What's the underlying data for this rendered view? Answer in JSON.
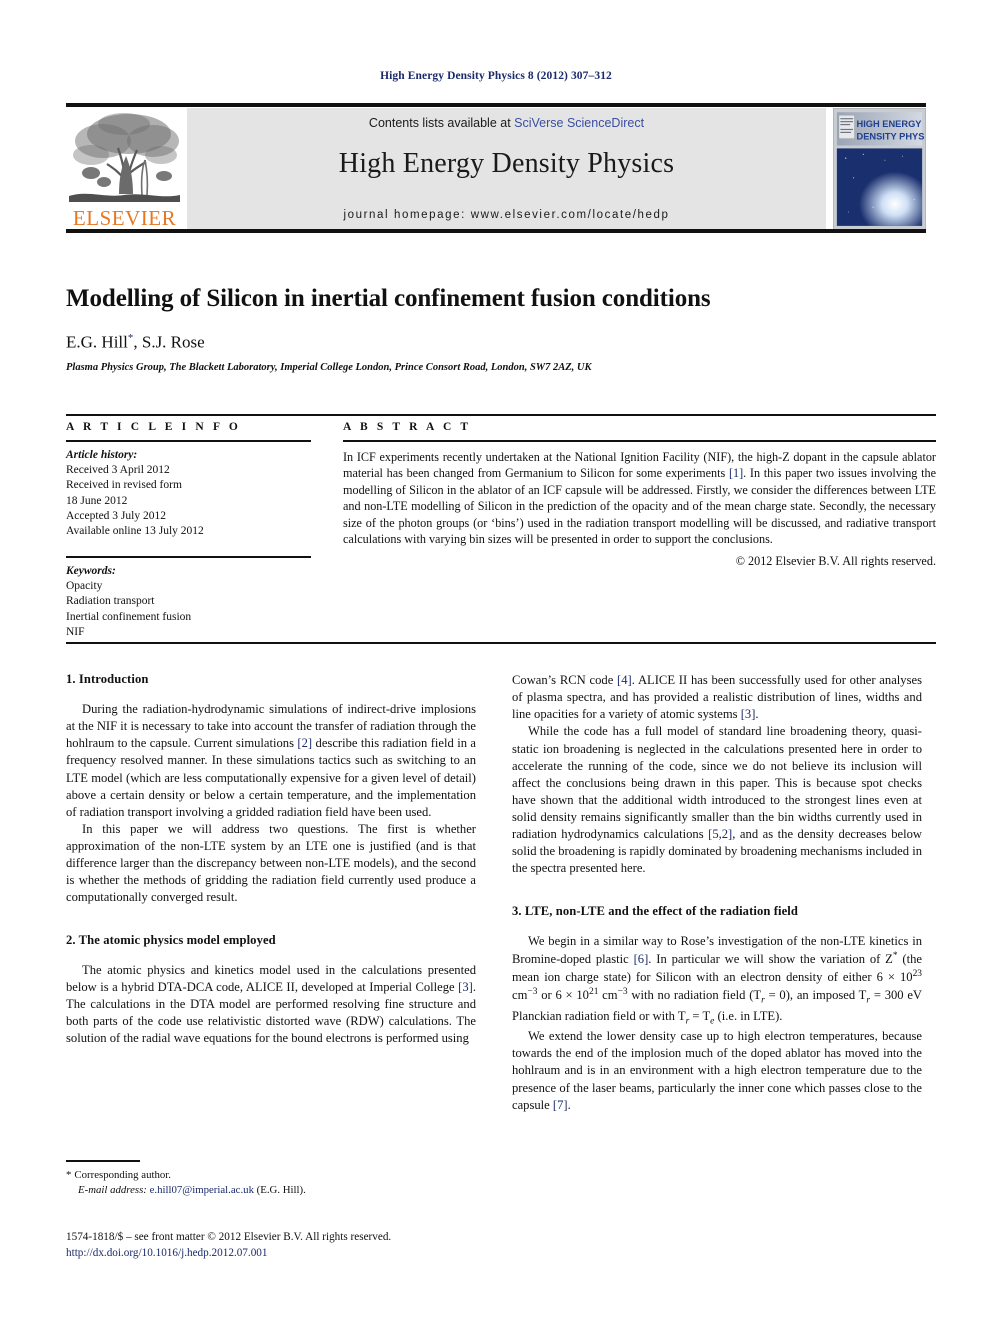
{
  "running_head": "High Energy Density Physics 8 (2012) 307–312",
  "masthead": {
    "publisher_name": "ELSEVIER",
    "contents_prefix": "Contents lists available at ",
    "contents_link": "SciVerse ScienceDirect",
    "journal_title": "High Energy Density Physics",
    "homepage": "journal homepage: www.elsevier.com/locate/hedp",
    "cover_title_line1": "HIGH ENERGY",
    "cover_title_line2": "DENSITY PHYSICS"
  },
  "article": {
    "title": "Modelling of Silicon in inertial confinement fusion conditions",
    "authors": "E.G. Hill",
    "authors_rest": ", S.J. Rose",
    "corresponding_marker": "*",
    "affiliation": "Plasma Physics Group, The Blackett Laboratory, Imperial College London, Prince Consort Road, London, SW7 2AZ, UK"
  },
  "info": {
    "heading": "A R T I C L E   I N F O",
    "history_label": "Article history:",
    "history": [
      "Received 3 April 2012",
      "Received in revised form",
      "18 June 2012",
      "Accepted 3 July 2012",
      "Available online 13 July 2012"
    ],
    "keywords_label": "Keywords:",
    "keywords": [
      "Opacity",
      "Radiation transport",
      "Inertial confinement fusion",
      "NIF"
    ]
  },
  "abstract": {
    "heading": "A B S T R A C T",
    "part1": "In ICF experiments recently undertaken at the National Ignition Facility (NIF), the high-Z dopant in the capsule ablator material has been changed from Germanium to Silicon for some experiments ",
    "ref1": "[1]",
    "part2": ". In this paper two issues involving the modelling of Silicon in the ablator of an ICF capsule will be addressed. Firstly, we consider the differences between LTE and non-LTE modelling of Silicon in the prediction of the opacity and of the mean charge state. Secondly, the necessary size of the photon groups (or ‘bins’) used in the radiation transport modelling will be discussed, and radiative transport calculations with varying bin sizes will be presented in order to support the conclusions.",
    "copyright": "© 2012 Elsevier B.V. All rights reserved."
  },
  "sections": {
    "intro_heading": "1.  Introduction",
    "intro_p1_a": "During the radiation-hydrodynamic simulations of indirect-drive implosions at the NIF it is necessary to take into account the transfer of radiation through the hohlraum to the capsule. Current simulations ",
    "intro_p1_ref": "[2]",
    "intro_p1_b": " describe this radiation field in a frequency resolved manner. In these simulations tactics such as switching to an LTE model (which are less computationally expensive for a given level of detail) above a certain density or below a certain temperature, and the implementation of radiation transport involving a gridded radiation field have been used.",
    "intro_p2": "In this paper we will address two questions. The first is whether approximation of the non-LTE system by an LTE one is justified (and is that difference larger than the discrepancy between non-LTE models), and the second is whether the methods of gridding the radiation field currently used produce a computationally converged result.",
    "atomic_heading": "2.  The atomic physics model employed",
    "atomic_p1_a": "The atomic physics and kinetics model used in the calculations presented below is a hybrid DTA-DCA code, ALICE II, developed at Imperial College ",
    "atomic_p1_ref": "[3]",
    "atomic_p1_b": ". The calculations in the DTA model are performed resolving fine structure and both parts of the code use relativistic distorted wave (RDW) calculations. The solution of the radial wave equations for the bound electrons is performed using",
    "right_p1_a": "Cowan’s RCN code ",
    "right_p1_ref1": "[4]",
    "right_p1_b": ". ALICE II has been successfully used for other analyses of plasma spectra, and has provided a realistic distribution of lines, widths and line opacities for a variety of atomic systems ",
    "right_p1_ref2": "[3]",
    "right_p1_c": ".",
    "right_p2_a": "While the code has a full model of standard line broadening theory, quasi-static ion broadening is neglected in the calculations presented here in order to accelerate the running of the code, since we do not believe its inclusion will affect the conclusions being drawn in this paper. This is because spot checks have shown that the additional width introduced to the strongest lines even at solid density remains significantly smaller than the bin widths currently used in radiation hydrodynamics calculations ",
    "right_p2_ref": "[5,2]",
    "right_p2_b": ", and as the density decreases below solid the broadening is rapidly dominated by broadening mechanisms included in the spectra presented here.",
    "lte_heading": "3.  LTE, non-LTE and the effect of the radiation field",
    "lte_p1_a": "We begin in a similar way to Rose’s investigation of the non-LTE kinetics in Bromine-doped plastic ",
    "lte_p1_ref": "[6]",
    "lte_p1_b": ". In particular we will show the variation of Z",
    "lte_p1_star": "*",
    "lte_p1_c": " (the mean ion charge state) for Silicon with an electron density of either 6 × 10",
    "lte_exp1": "23",
    "lte_p1_d": " cm",
    "lte_exp2": "−3",
    "lte_p1_e": " or 6 × 10",
    "lte_exp3": "21",
    "lte_p1_f": " cm",
    "lte_exp4": "−3",
    "lte_p1_g": " with no radiation field (T",
    "lte_sub1": "r",
    "lte_p1_h": " = 0), an imposed T",
    "lte_sub2": "r",
    "lte_p1_i": " = 300 eV Planckian radiation field or with T",
    "lte_sub3": "r",
    "lte_p1_j": " = T",
    "lte_sub4": "e",
    "lte_p1_k": " (i.e. in LTE).",
    "lte_p2_a": "We extend the lower density case up to high electron temperatures, because towards the end of the implosion much of the doped ablator has moved into the hohlraum and is in an environment with a high electron temperature due to the presence of the laser beams, particularly the inner cone which passes close to the capsule ",
    "lte_p2_ref": "[7]",
    "lte_p2_b": "."
  },
  "footer": {
    "corresponding_star": "*",
    "corresponding_label": "Corresponding author.",
    "email_label": "E-mail address:",
    "email": "e.hill07@imperial.ac.uk",
    "email_attrib": " (E.G. Hill).",
    "issn_line": "1574-1818/$ – see front matter © 2012 Elsevier B.V. All rights reserved.",
    "doi": "http://dx.doi.org/10.1016/j.hedp.2012.07.001"
  },
  "colors": {
    "link_blue": "#1b2a6b",
    "sciencedirect_blue": "#3b4ea0",
    "elsevier_orange": "#e87722",
    "panel_gray": "#e4e4e4"
  }
}
